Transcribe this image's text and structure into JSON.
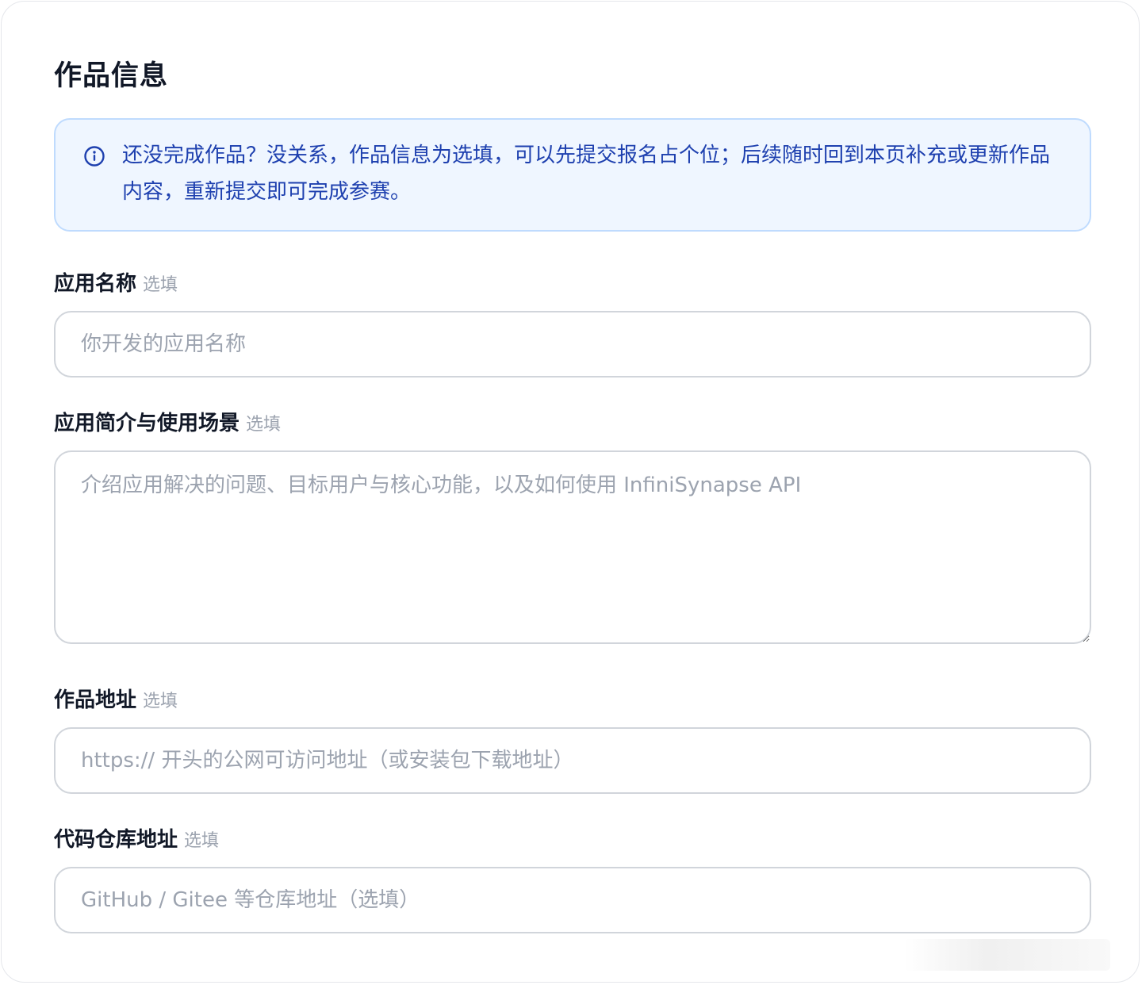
{
  "section": {
    "title": "作品信息"
  },
  "notice": {
    "icon": "info-circle-icon",
    "text": "还没完成作品？没关系，作品信息为选填，可以先提交报名占个位；后续随时回到本页补充或更新作品内容，重新提交即可完成参赛。",
    "color": "#1e40af",
    "background": "#eff6ff"
  },
  "fields": {
    "app_name": {
      "label": "应用名称",
      "optional": "选填",
      "placeholder": "你开发的应用名称",
      "value": ""
    },
    "app_description": {
      "label": "应用简介与使用场景",
      "optional": "选填",
      "placeholder": "介绍应用解决的问题、目标用户与核心功能，以及如何使用 InfiniSynapse API",
      "value": ""
    },
    "project_url": {
      "label": "作品地址",
      "optional": "选填",
      "placeholder": "https:// 开头的公网可访问地址（或安装包下载地址）",
      "value": ""
    },
    "repo_url": {
      "label": "代码仓库地址",
      "optional": "选填",
      "placeholder": "GitHub / Gitee 等仓库地址（选填）",
      "value": ""
    }
  }
}
